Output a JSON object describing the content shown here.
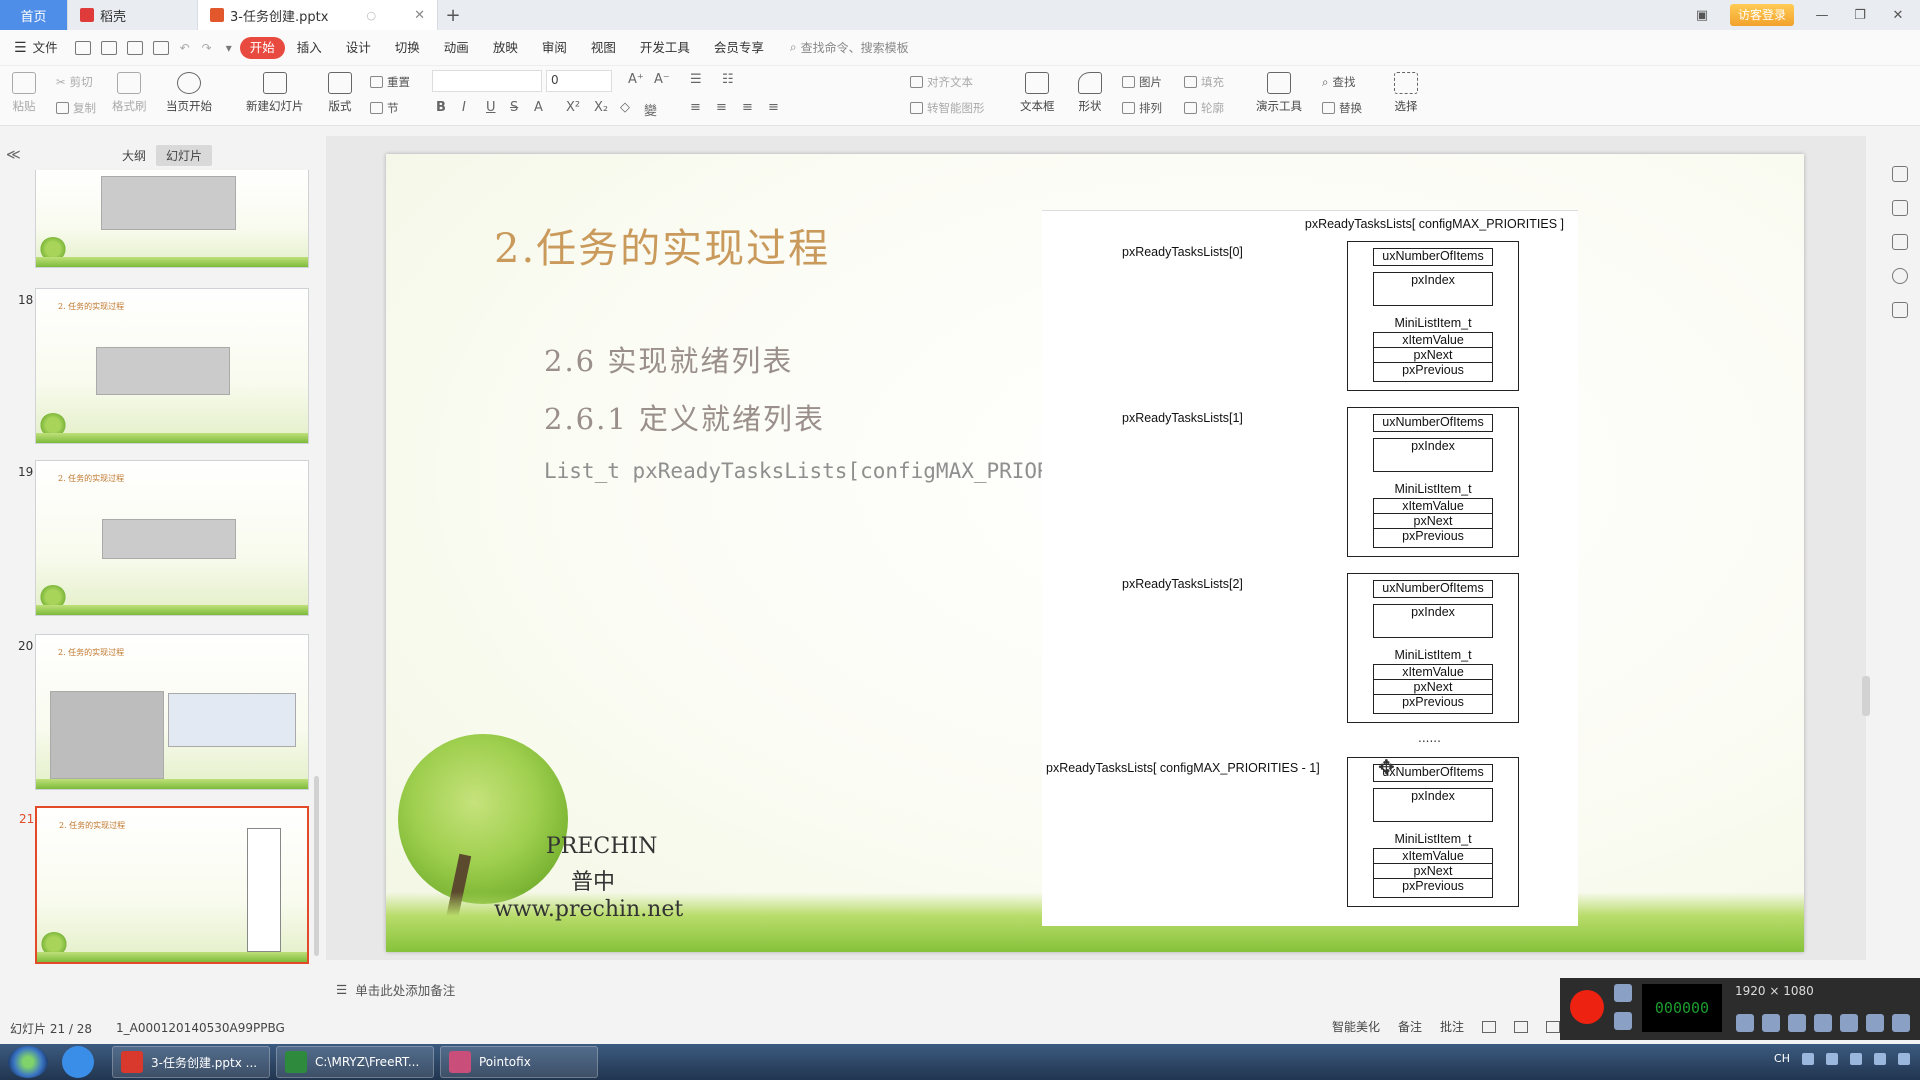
{
  "titlebar": {
    "home_tab": "首页",
    "tab_daoke": "稻壳",
    "active_doc": "3-任务创建.pptx",
    "new_tab": "+",
    "login": "访客登录"
  },
  "menu": {
    "file": "文件",
    "items": [
      "开始",
      "插入",
      "设计",
      "切换",
      "动画",
      "放映",
      "审阅",
      "视图",
      "开发工具",
      "会员专享"
    ],
    "search_placeholder": "查找命令、搜索模板"
  },
  "ribbon": {
    "paste": "粘贴",
    "cut": "剪切",
    "copy": "复制",
    "format_painter": "格式刷",
    "from_current": "当页开始",
    "new_slide": "新建幻灯片",
    "layout": "版式",
    "reset": "重置",
    "section": "节",
    "font_size": "0",
    "align_text": "对齐文本",
    "convert_smartart": "转智能图形",
    "textbox": "文本框",
    "shape": "形状",
    "picture": "图片",
    "fill": "填充",
    "arrange": "排列",
    "outline": "轮廓",
    "presenter_tools": "演示工具",
    "find": "查找",
    "replace": "替换",
    "select": "选择"
  },
  "leftpanel": {
    "tab_outline": "大纲",
    "tab_slides": "幻灯片",
    "collapse": "≪",
    "add": "+",
    "thumbs": [
      {
        "num": "",
        "title": ""
      },
      {
        "num": "18",
        "title": "2. 任务的实现过程"
      },
      {
        "num": "19",
        "title": "2. 任务的实现过程"
      },
      {
        "num": "20",
        "title": "2. 任务的实现过程"
      },
      {
        "num": "21",
        "title": "2. 任务的实现过程"
      }
    ]
  },
  "slide": {
    "title": "2.任务的实现过程",
    "sub1": "2.6 实现就绪列表",
    "sub2": "2.6.1 定义就绪列表",
    "code": "List_t pxReadyTasksLists[configMAX_PRIORITIES ];",
    "brand_en": "PRECHIN",
    "brand_cn": "普中",
    "brand_url": "www.prechin.net"
  },
  "diagram": {
    "header": "pxReadyTasksLists[ configMAX_PRIORITIES ]",
    "labels": [
      "pxReadyTasksLists[0]",
      "pxReadyTasksLists[1]",
      "pxReadyTasksLists[2]",
      "pxReadyTasksLists[ configMAX_PRIORITIES - 1]"
    ],
    "ellipsis": "......",
    "fields": {
      "count": "uxNumberOfItems",
      "index": "pxIndex",
      "mini": "MiniListItem_t",
      "value": "xItemValue",
      "next": "pxNext",
      "prev": "pxPrevious"
    }
  },
  "notes": {
    "placeholder": "单击此处添加备注"
  },
  "status": {
    "slide_info": "幻灯片 21 / 28",
    "template": "1_A000120140530A99PPBG",
    "smart": "智能美化",
    "remark": "备注",
    "comment": "批注"
  },
  "recorder": {
    "time": "000000",
    "resolution": "1920 × 1080"
  },
  "taskbar": {
    "tasks": [
      "3-任务创建.pptx ...",
      "C:\\MRYZ\\FreeRT...",
      "Pointofix"
    ],
    "lang": "CH"
  },
  "colors": {
    "accent": "#e94a3f",
    "home_tab": "#4e8de8",
    "title": "#c99a5b"
  }
}
